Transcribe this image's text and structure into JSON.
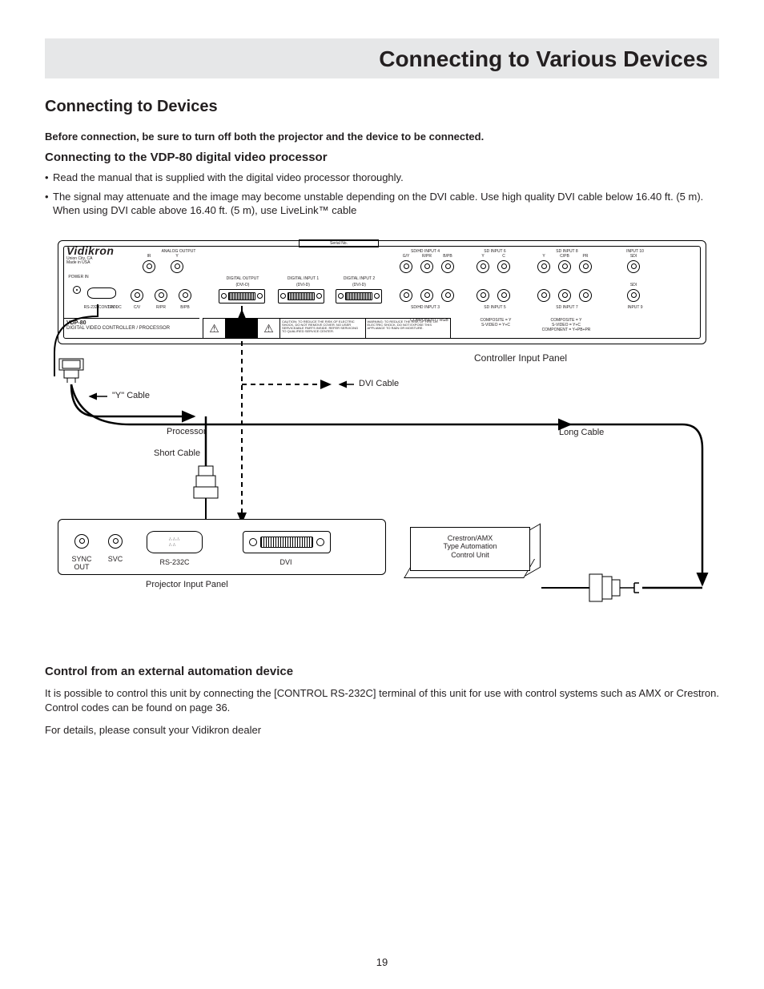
{
  "titlebar": "Connecting to Various Devices",
  "h2": "Connecting to Devices",
  "warn": "Before connection, be sure to turn off both the projector and the device to be connected.",
  "h3a": "Connecting to the VDP-80 digital video processor",
  "bullets": [
    "Read the manual that is supplied with the digital video processor thoroughly.",
    "The signal may attenuate and the image may become unstable depending on the DVI cable. Use high quality DVI cable below 16.40 ft. (5 m). When using DVI cable above 16.40 ft. (5 m), use LiveLink™ cable"
  ],
  "diagram": {
    "brand": "Vidikron",
    "brand_sub1": "Union City, CA",
    "brand_sub2": "Made in USA",
    "analog_output": "ANALOG OUTPUT",
    "digital_output": "DIGITAL OUTPUT",
    "digital_input1": "DIGITAL INPUT 1",
    "digital_input2": "DIGITAL INPUT 2",
    "dvid": "(DVI-D)",
    "sdhd4": "SD/HD INPUT 4",
    "sdhd3": "SD/HD INPUT 3",
    "sd6": "SD INPUT 6",
    "sd5": "SD INPUT 5",
    "sd8": "SD INPUT 8",
    "sd7": "SD INPUT 7",
    "in10": "INPUT 10",
    "in9": "INPUT 9",
    "sdi": "SDI",
    "power_in": "POWER IN",
    "rs232c": "RS-232 CONTROL",
    "componentrgb": "COMPONENT / RGB",
    "labels_top": [
      "IR",
      "Y",
      "12V DC",
      "C/V",
      "R/PR",
      "B/PB"
    ],
    "rgb_labels": [
      "G/Y",
      "R/PR",
      "B/PB"
    ],
    "sd_labels": [
      "Y",
      "C",
      "Y",
      "C/PB",
      "PR"
    ],
    "comp_y": "COMPOSITE = Y",
    "svideo": "S-VIDEO = Y+C",
    "compyp": "COMPONENT = Y+PB+PR",
    "model": "VDP-80",
    "model_sub": "DIGITAL VIDEO CONTROLLER / PROCESSOR",
    "caution": "CAUTION: TO REDUCE THE RISK OF ELECTRIC SHOCK, DO NOT REMOVE COVER. NO USER SERVICEABLE PARTS INSIDE. REFER SERVICING TO QUALIFIED SERVICE CENTER.",
    "warning": "WARNING: TO REDUCE THE RISK OF FIRE OR ELECTRIC SHOCK, DO NOT EXPOSE THIS APPLIANCE TO RAIN OR MOISTURE.",
    "serial": "Serial No.",
    "ctrl_label": "Controller Input Panel",
    "ycable": "\"Y\" Cable",
    "dvicable": "DVI Cable",
    "processor": "Processor",
    "shortcable": "Short Cable",
    "longcable": "Long Cable",
    "proj_label": "Projector Input Panel",
    "sync": "SYNC OUT",
    "svc": "SVC",
    "rs232": "RS-232C",
    "dvi": "DVI",
    "automation1": "Crestron/AMX",
    "automation2": "Type Automation",
    "automation3": "Control Unit"
  },
  "h3b": "Control from an external automation device",
  "p1": "It is possible to control this unit by connecting the [CONTROL RS-232C] terminal of this unit for use with control systems such as AMX or Crestron. Control codes can be found on page 36.",
  "p2": "For details, please consult your Vidikron dealer",
  "page": "19"
}
